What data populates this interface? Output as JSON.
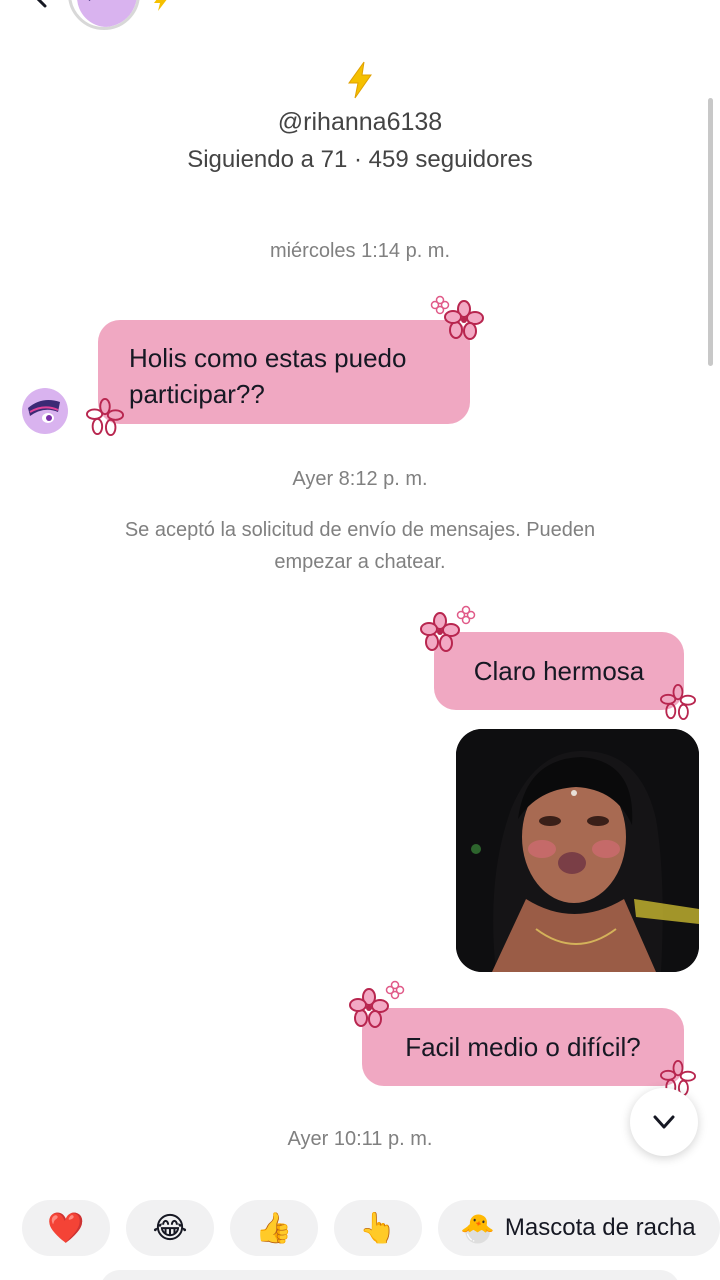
{
  "header": {
    "back_icon": "chevron-left-icon",
    "avatar_icon": "pony-avatar",
    "streak_icon": "lightning-bolt-icon"
  },
  "profile": {
    "username": "@rihanna6138",
    "follow_info": "Siguiendo a 71 · 459 seguidores"
  },
  "messages": {
    "ts1": "miércoles 1:14 p. m.",
    "msg1": "Holis como estas puedo participar??",
    "ts2": "Ayer 8:12 p. m.",
    "system": "Se aceptó la solicitud de envío de mensajes. Pueden empezar a chatear.",
    "msg2": "Claro hermosa",
    "msg3": "Facil medio o difícil?",
    "ts3": "Ayer 10:11 p. m."
  },
  "quick_replies": {
    "heart": "❤️",
    "laugh": "😂",
    "thumbs": "👍",
    "point": "👆",
    "mascot_emoji": "🐣",
    "mascot_label": "Mascota de racha"
  },
  "colors": {
    "bubble": "#f0a8c2",
    "flower": "#c0305e",
    "bolt": "#f5c000"
  }
}
